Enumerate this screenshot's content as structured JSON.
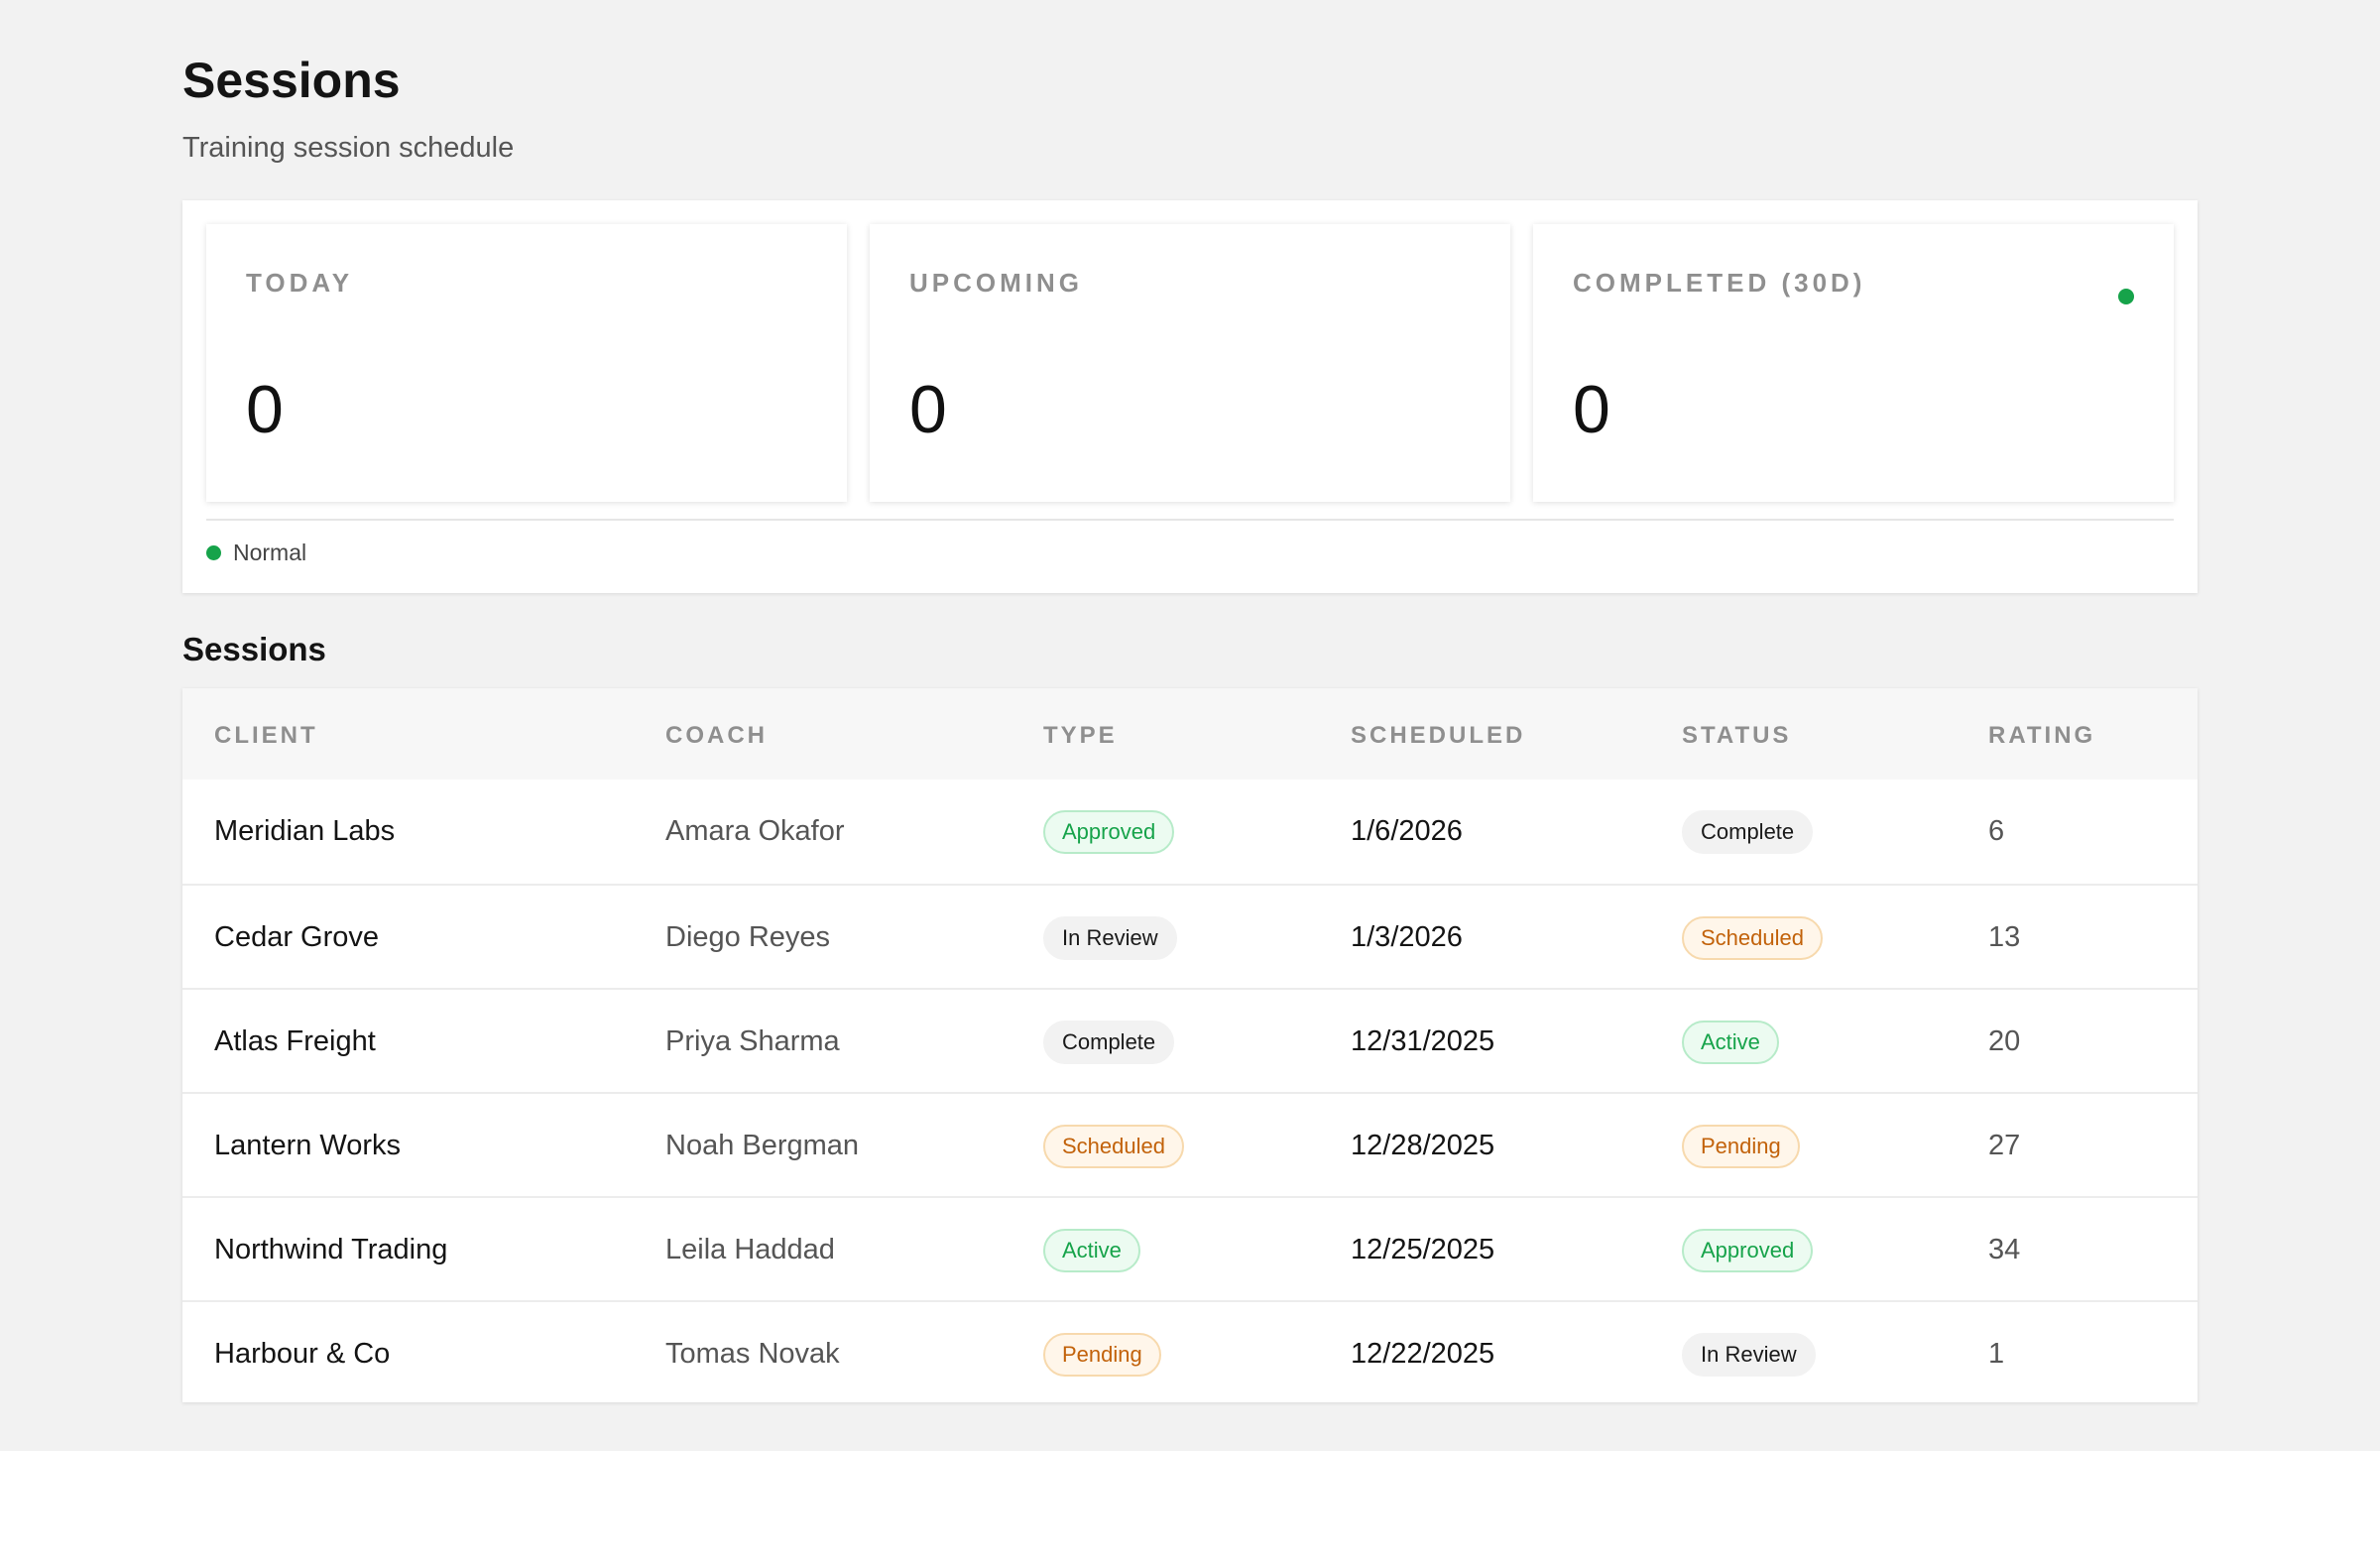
{
  "header": {
    "title": "Sessions",
    "subtitle": "Training session schedule"
  },
  "stats": [
    {
      "label": "TODAY",
      "value": "0"
    },
    {
      "label": "UPCOMING",
      "value": "0"
    },
    {
      "label": "COMPLETED (30D)",
      "value": "0"
    }
  ],
  "legend": {
    "label": "Normal",
    "color": "#16a34a"
  },
  "table": {
    "title": "Sessions",
    "columns": [
      "CLIENT",
      "COACH",
      "TYPE",
      "SCHEDULED",
      "STATUS",
      "RATING"
    ],
    "rows": [
      {
        "client": "Meridian Labs",
        "coach": "Amara Okafor",
        "type": "Approved",
        "scheduled": "1/6/2026",
        "status": "Complete",
        "rating": "6"
      },
      {
        "client": "Cedar Grove",
        "coach": "Diego Reyes",
        "type": "In Review",
        "scheduled": "1/3/2026",
        "status": "Scheduled",
        "rating": "13"
      },
      {
        "client": "Atlas Freight",
        "coach": "Priya Sharma",
        "type": "Complete",
        "scheduled": "12/31/2025",
        "status": "Active",
        "rating": "20"
      },
      {
        "client": "Lantern Works",
        "coach": "Noah Bergman",
        "type": "Scheduled",
        "scheduled": "12/28/2025",
        "status": "Pending",
        "rating": "27"
      },
      {
        "client": "Northwind Trading",
        "coach": "Leila Haddad",
        "type": "Active",
        "scheduled": "12/25/2025",
        "status": "Approved",
        "rating": "34"
      },
      {
        "client": "Harbour & Co",
        "coach": "Tomas Novak",
        "type": "Pending",
        "scheduled": "12/22/2025",
        "status": "In Review",
        "rating": "1"
      }
    ]
  },
  "badge_colors": {
    "green": "#16a34a",
    "orange": "#c2620a",
    "gray": "#1a1a1a"
  }
}
